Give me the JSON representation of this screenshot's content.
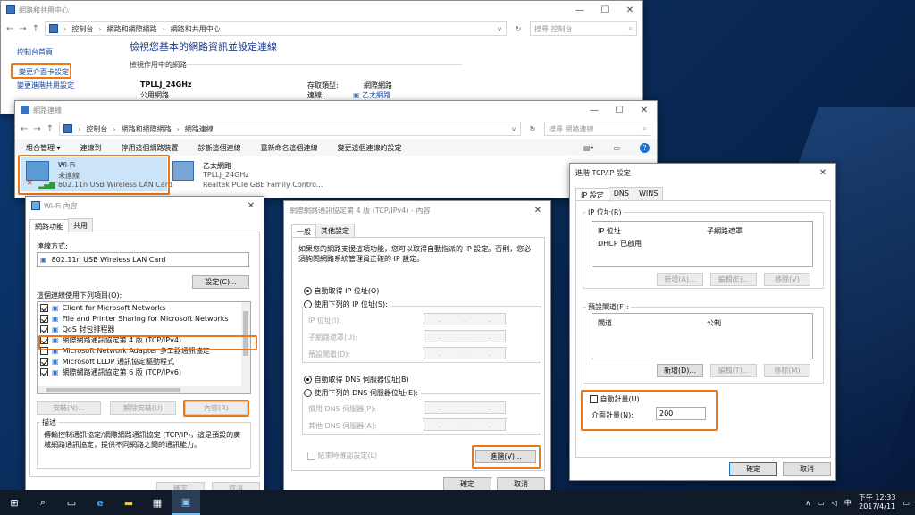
{
  "w1": {
    "title": "網路和共用中心",
    "breadcrumb": [
      "控制台",
      "網路和網際網路",
      "網路和共用中心"
    ],
    "search_placeholder": "搜尋 控制台",
    "side_links": [
      "控制台首頁",
      "變更介面卡設定",
      "變更進階共用設定"
    ],
    "heading": "檢視您基本的網路資訊並設定連線",
    "active_networks_label": "檢視作用中的網路",
    "network_name": "TPLLJ_24GHz",
    "network_type": "公用網路",
    "access_type_label": "存取類型:",
    "access_type_value": "網際網路",
    "connection_label": "連線:",
    "connection_value": "乙太網路"
  },
  "w2": {
    "title": "網路連線",
    "breadcrumb": [
      "控制台",
      "網路和網際網路",
      "網路連線"
    ],
    "search_placeholder": "搜尋 網路連線",
    "toolbar": [
      "組合管理 ▾",
      "連線到",
      "停用這個網路裝置",
      "診斷這個連線",
      "重新命名這個連線",
      "變更這個連線的設定"
    ],
    "adapters": [
      {
        "name": "Wi-Fi",
        "status": "未連線",
        "device": "802.11n USB Wireless LAN Card"
      },
      {
        "name": "乙太網路",
        "status": "TPLLJ_24GHz",
        "device": "Realtek PCIe GBE Family Contro..."
      }
    ]
  },
  "w3": {
    "title": "Wi-Fi 內容",
    "tabs": [
      "網路功能",
      "共用"
    ],
    "connect_using_label": "連線方式:",
    "adapter": "802.11n USB Wireless LAN Card",
    "configure_btn": "設定(C)...",
    "items_label": "這個連線使用下列項目(O):",
    "items": [
      {
        "label": "Client for Microsoft Networks",
        "checked": true
      },
      {
        "label": "File and Printer Sharing for Microsoft Networks",
        "checked": true
      },
      {
        "label": "QoS 封包排程器",
        "checked": true
      },
      {
        "label": "網際網路通訊協定第 4 版 (TCP/IPv4)",
        "checked": true
      },
      {
        "label": "Microsoft Network Adapter 多工器通訊協定",
        "checked": false
      },
      {
        "label": "Microsoft LLDP 通訊協定驅動程式",
        "checked": true
      },
      {
        "label": "網際網路通訊協定第 6 版 (TCP/IPv6)",
        "checked": true
      }
    ],
    "install_btn": "安裝(N)...",
    "uninstall_btn": "解除安裝(U)",
    "properties_btn": "內容(R)",
    "desc_label": "描述",
    "desc_text": "傳輸控制通訊協定/網際網路通訊協定 (TCP/IP)，這是預設的廣域網路通訊協定，提供不同網路之間的通訊能力。",
    "ok": "確定",
    "cancel": "取消"
  },
  "w4": {
    "title": "網際網路通訊協定第 4 版 (TCP/IPv4) - 內容",
    "tabs": [
      "一般",
      "其他設定"
    ],
    "intro": "如果您的網路支援這項功能，您可以取得自動指派的 IP 設定。否則，您必須詢問網路系統管理員正確的 IP 設定。",
    "auto_ip": "自動取得 IP 位址(O)",
    "manual_ip": "使用下列的 IP 位址(S):",
    "ip_label": "IP 位址(I):",
    "mask_label": "子網路遮罩(U):",
    "gateway_label": "預設閘道(D):",
    "auto_dns": "自動取得 DNS 伺服器位址(B)",
    "manual_dns": "使用下列的 DNS 伺服器位址(E):",
    "pref_dns": "慣用 DNS 伺服器(P):",
    "alt_dns": "其他 DNS 伺服器(A):",
    "validate": "結束時確認設定(L)",
    "advanced_btn": "進階(V)...",
    "ok": "確定",
    "cancel": "取消"
  },
  "w5": {
    "title": "進階 TCP/IP 設定",
    "tabs": [
      "IP 設定",
      "DNS",
      "WINS"
    ],
    "ip_group": "IP 位址(R)",
    "ip_col1": "IP 位址",
    "ip_col2": "子網路遮罩",
    "ip_row": "DHCP 已啟用",
    "add_btn": "新增(A)...",
    "edit_btn": "編輯(E)...",
    "remove_btn": "移除(V)",
    "gw_group": "預設閘道(F):",
    "gw_col1": "閘道",
    "gw_col2": "公制",
    "gw_add": "新增(D)...",
    "gw_edit": "編輯(T)...",
    "gw_remove": "移除(M)",
    "auto_metric": "自動計量(U)",
    "metric_label": "介面計量(N):",
    "metric_value": "200",
    "ok": "確定",
    "cancel": "取消"
  },
  "taskbar": {
    "time": "下午 12:33",
    "date": "2017/4/11",
    "ime": "中"
  }
}
